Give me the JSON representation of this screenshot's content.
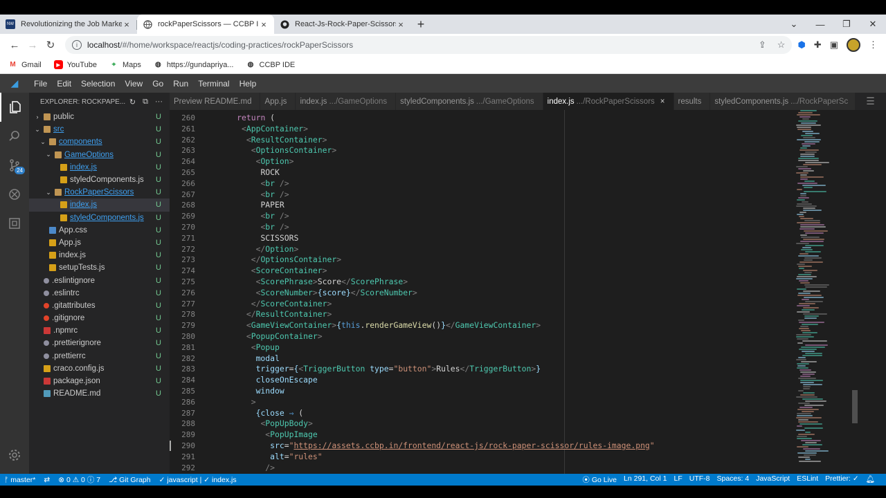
{
  "browser": {
    "tabs": [
      {
        "title": "Revolutionizing the Job Market |",
        "active": false
      },
      {
        "title": "rockPaperScissors — CCBP IDE",
        "active": true
      },
      {
        "title": "React-Js-Rock-Paper-Scissors/Ap",
        "active": false
      }
    ],
    "url_host": "localhost",
    "url_path": "/#/home/workspace/reactjs/coding-practices/rockPaperScissors",
    "bookmarks": [
      "Gmail",
      "YouTube",
      "Maps",
      "https://gundapriya...",
      "CCBP IDE"
    ]
  },
  "vscode": {
    "menu": [
      "File",
      "Edit",
      "Selection",
      "View",
      "Go",
      "Run",
      "Terminal",
      "Help"
    ],
    "explorer_title": "EXPLORER: ROCKPAPE...",
    "scm_badge": "24",
    "tree": [
      {
        "name": "public",
        "depth": 0,
        "kind": "folder",
        "open": false,
        "status": "U",
        "style": "plain"
      },
      {
        "name": "src",
        "depth": 0,
        "kind": "folder",
        "open": true,
        "status": "U",
        "style": "blue"
      },
      {
        "name": "components",
        "depth": 1,
        "kind": "folder",
        "open": true,
        "status": "U",
        "style": "blue"
      },
      {
        "name": "GameOptions",
        "depth": 2,
        "kind": "folder",
        "open": true,
        "status": "U",
        "style": "blue"
      },
      {
        "name": "index.js",
        "depth": 3,
        "kind": "js",
        "status": "U",
        "style": "blue"
      },
      {
        "name": "styledComponents.js",
        "depth": 3,
        "kind": "js",
        "status": "U",
        "style": "plain"
      },
      {
        "name": "RockPaperScissors",
        "depth": 2,
        "kind": "folder",
        "open": true,
        "status": "U",
        "style": "blue"
      },
      {
        "name": "index.js",
        "depth": 3,
        "kind": "js",
        "status": "U",
        "style": "blue",
        "selected": true
      },
      {
        "name": "styledComponents.js",
        "depth": 3,
        "kind": "js",
        "status": "U",
        "style": "blue"
      },
      {
        "name": "App.css",
        "depth": 1,
        "kind": "css",
        "status": "U",
        "style": "plain"
      },
      {
        "name": "App.js",
        "depth": 1,
        "kind": "js",
        "status": "U",
        "style": "plain"
      },
      {
        "name": "index.js",
        "depth": 1,
        "kind": "js",
        "status": "U",
        "style": "plain"
      },
      {
        "name": "setupTests.js",
        "depth": 1,
        "kind": "js",
        "status": "U",
        "style": "plain"
      },
      {
        "name": ".eslintignore",
        "depth": 0,
        "kind": "cfg",
        "status": "U",
        "style": "plain"
      },
      {
        "name": ".eslintrc",
        "depth": 0,
        "kind": "cfg",
        "status": "U",
        "style": "plain"
      },
      {
        "name": ".gitattributes",
        "depth": 0,
        "kind": "git",
        "status": "U",
        "style": "plain"
      },
      {
        "name": ".gitignore",
        "depth": 0,
        "kind": "git",
        "status": "U",
        "style": "plain"
      },
      {
        "name": ".npmrc",
        "depth": 0,
        "kind": "npm",
        "status": "U",
        "style": "plain"
      },
      {
        "name": ".prettierignore",
        "depth": 0,
        "kind": "cfg",
        "status": "U",
        "style": "plain"
      },
      {
        "name": ".prettierrc",
        "depth": 0,
        "kind": "cfg",
        "status": "U",
        "style": "plain"
      },
      {
        "name": "craco.config.js",
        "depth": 0,
        "kind": "js",
        "status": "U",
        "style": "plain"
      },
      {
        "name": "package.json",
        "depth": 0,
        "kind": "npm",
        "status": "U",
        "style": "plain"
      },
      {
        "name": "README.md",
        "depth": 0,
        "kind": "md",
        "status": "U",
        "style": "plain"
      }
    ],
    "editor_tabs": [
      {
        "label": "Preview README.md",
        "desc": "",
        "active": false
      },
      {
        "label": "App.js",
        "desc": "",
        "active": false
      },
      {
        "label": "index.js",
        "desc": ".../GameOptions",
        "active": false
      },
      {
        "label": "styledComponents.js",
        "desc": ".../GameOptions",
        "active": false
      },
      {
        "label": "index.js",
        "desc": ".../RockPaperScissors",
        "active": true
      },
      {
        "label": "results",
        "desc": "",
        "active": false
      },
      {
        "label": "styledComponents.js",
        "desc": ".../RockPaperSc",
        "active": false
      }
    ],
    "first_line_number": 260,
    "code_lines": [
      [
        [
          6,
          ""
        ],
        [
          "kw",
          "return"
        ],
        [
          "txt",
          " ("
        ]
      ],
      [
        [
          7,
          ""
        ],
        [
          "punc",
          "<"
        ],
        [
          "tag",
          "AppContainer"
        ],
        [
          "punc",
          ">"
        ]
      ],
      [
        [
          8,
          ""
        ],
        [
          "punc",
          "<"
        ],
        [
          "tag",
          "ResultContainer"
        ],
        [
          "punc",
          ">"
        ]
      ],
      [
        [
          9,
          ""
        ],
        [
          "punc",
          "<"
        ],
        [
          "tag",
          "OptionsContainer"
        ],
        [
          "punc",
          ">"
        ]
      ],
      [
        [
          10,
          ""
        ],
        [
          "punc",
          "<"
        ],
        [
          "tag",
          "Option"
        ],
        [
          "punc",
          ">"
        ]
      ],
      [
        [
          11,
          ""
        ],
        [
          "txt",
          "ROCK"
        ]
      ],
      [
        [
          11,
          ""
        ],
        [
          "punc",
          "<"
        ],
        [
          "tag",
          "br"
        ],
        [
          "punc",
          " />"
        ]
      ],
      [
        [
          11,
          ""
        ],
        [
          "punc",
          "<"
        ],
        [
          "tag",
          "br"
        ],
        [
          "punc",
          " />"
        ]
      ],
      [
        [
          11,
          ""
        ],
        [
          "txt",
          "PAPER"
        ]
      ],
      [
        [
          11,
          ""
        ],
        [
          "punc",
          "<"
        ],
        [
          "tag",
          "br"
        ],
        [
          "punc",
          " />"
        ]
      ],
      [
        [
          11,
          ""
        ],
        [
          "punc",
          "<"
        ],
        [
          "tag",
          "br"
        ],
        [
          "punc",
          " />"
        ]
      ],
      [
        [
          11,
          ""
        ],
        [
          "txt",
          "SCISSORS"
        ]
      ],
      [
        [
          10,
          ""
        ],
        [
          "punc",
          "</"
        ],
        [
          "tag",
          "Option"
        ],
        [
          "punc",
          ">"
        ]
      ],
      [
        [
          9,
          ""
        ],
        [
          "punc",
          "</"
        ],
        [
          "tag",
          "OptionsContainer"
        ],
        [
          "punc",
          ">"
        ]
      ],
      [
        [
          9,
          ""
        ],
        [
          "punc",
          "<"
        ],
        [
          "tag",
          "ScoreContainer"
        ],
        [
          "punc",
          ">"
        ]
      ],
      [
        [
          10,
          ""
        ],
        [
          "punc",
          "<"
        ],
        [
          "tag",
          "ScorePhrase"
        ],
        [
          "punc",
          ">"
        ],
        [
          "txt",
          "Score"
        ],
        [
          "punc",
          "</"
        ],
        [
          "tag",
          "ScorePhrase"
        ],
        [
          "punc",
          ">"
        ]
      ],
      [
        [
          10,
          ""
        ],
        [
          "punc",
          "<"
        ],
        [
          "tag",
          "ScoreNumber"
        ],
        [
          "punc",
          ">"
        ],
        [
          "attr",
          "{"
        ],
        [
          "var",
          "score"
        ],
        [
          "attr",
          "}"
        ],
        [
          "punc",
          "</"
        ],
        [
          "tag",
          "ScoreNumber"
        ],
        [
          "punc",
          ">"
        ]
      ],
      [
        [
          9,
          ""
        ],
        [
          "punc",
          "</"
        ],
        [
          "tag",
          "ScoreContainer"
        ],
        [
          "punc",
          ">"
        ]
      ],
      [
        [
          8,
          ""
        ],
        [
          "punc",
          "</"
        ],
        [
          "tag",
          "ResultContainer"
        ],
        [
          "punc",
          ">"
        ]
      ],
      [
        [
          8,
          ""
        ],
        [
          "punc",
          "<"
        ],
        [
          "tag",
          "GameViewContainer"
        ],
        [
          "punc",
          ">"
        ],
        [
          "attr",
          "{"
        ],
        [
          "this",
          "this"
        ],
        [
          "txt",
          "."
        ],
        [
          "fn",
          "renderGameView"
        ],
        [
          "txt",
          "()"
        ],
        [
          "attr",
          "}"
        ],
        [
          "punc",
          "</"
        ],
        [
          "tag",
          "GameViewContainer"
        ],
        [
          "punc",
          ">"
        ]
      ],
      [
        [
          8,
          ""
        ],
        [
          "punc",
          "<"
        ],
        [
          "tag",
          "PopupContainer"
        ],
        [
          "punc",
          ">"
        ]
      ],
      [
        [
          9,
          ""
        ],
        [
          "punc",
          "<"
        ],
        [
          "tag",
          "Popup"
        ]
      ],
      [
        [
          10,
          ""
        ],
        [
          "attr",
          "modal"
        ]
      ],
      [
        [
          10,
          ""
        ],
        [
          "attr",
          "trigger"
        ],
        [
          "txt",
          "="
        ],
        [
          "attr",
          "{"
        ],
        [
          "punc",
          "<"
        ],
        [
          "tag",
          "TriggerButton"
        ],
        [
          "txt",
          " "
        ],
        [
          "attr",
          "type"
        ],
        [
          "txt",
          "="
        ],
        [
          "str",
          "\"button\""
        ],
        [
          "punc",
          ">"
        ],
        [
          "txt",
          "Rules"
        ],
        [
          "punc",
          "</"
        ],
        [
          "tag",
          "TriggerButton"
        ],
        [
          "punc",
          ">"
        ],
        [
          "attr",
          "}"
        ]
      ],
      [
        [
          10,
          ""
        ],
        [
          "attr",
          "closeOnEscape"
        ]
      ],
      [
        [
          10,
          ""
        ],
        [
          "attr",
          "window"
        ]
      ],
      [
        [
          9,
          ""
        ],
        [
          "punc",
          ">"
        ]
      ],
      [
        [
          10,
          ""
        ],
        [
          "attr",
          "{"
        ],
        [
          "var",
          "close"
        ],
        [
          "txt",
          " "
        ],
        [
          "this",
          "⇒"
        ],
        [
          "txt",
          " ("
        ]
      ],
      [
        [
          11,
          ""
        ],
        [
          "punc",
          "<"
        ],
        [
          "tag",
          "PopUpBody"
        ],
        [
          "punc",
          ">"
        ]
      ],
      [
        [
          12,
          ""
        ],
        [
          "punc",
          "<"
        ],
        [
          "tag",
          "PopUpImage"
        ]
      ],
      [
        [
          13,
          ""
        ],
        [
          "attr",
          "src"
        ],
        [
          "txt",
          "="
        ],
        [
          "str",
          "\""
        ],
        [
          "url",
          "https://assets.ccbp.in/frontend/react-js/rock-paper-scissor/rules-image.png"
        ],
        [
          "str",
          "\""
        ]
      ],
      [
        [
          13,
          ""
        ],
        [
          "attr",
          "alt"
        ],
        [
          "txt",
          "="
        ],
        [
          "str",
          "\"rules\""
        ]
      ],
      [
        [
          12,
          ""
        ],
        [
          "punc",
          "/>"
        ]
      ]
    ],
    "status": {
      "branch": "master*",
      "errors": "0",
      "warnings": "0",
      "info": "7",
      "git_graph": "Git Graph",
      "language_check": "javascript",
      "file": "index.js",
      "go_live": "Go Live",
      "position": "Ln 291, Col 1",
      "eol": "LF",
      "encoding": "UTF-8",
      "spaces": "Spaces: 4",
      "language": "JavaScript",
      "linter": "ESLint",
      "prettier": "Prettier: ✓"
    }
  },
  "colors": {
    "statusbar": "#007acc",
    "editor_bg": "#1e1e1e",
    "sidebar_bg": "#252526",
    "tag": "#4ec9b0",
    "attr": "#9cdcfe",
    "string": "#ce9178"
  }
}
